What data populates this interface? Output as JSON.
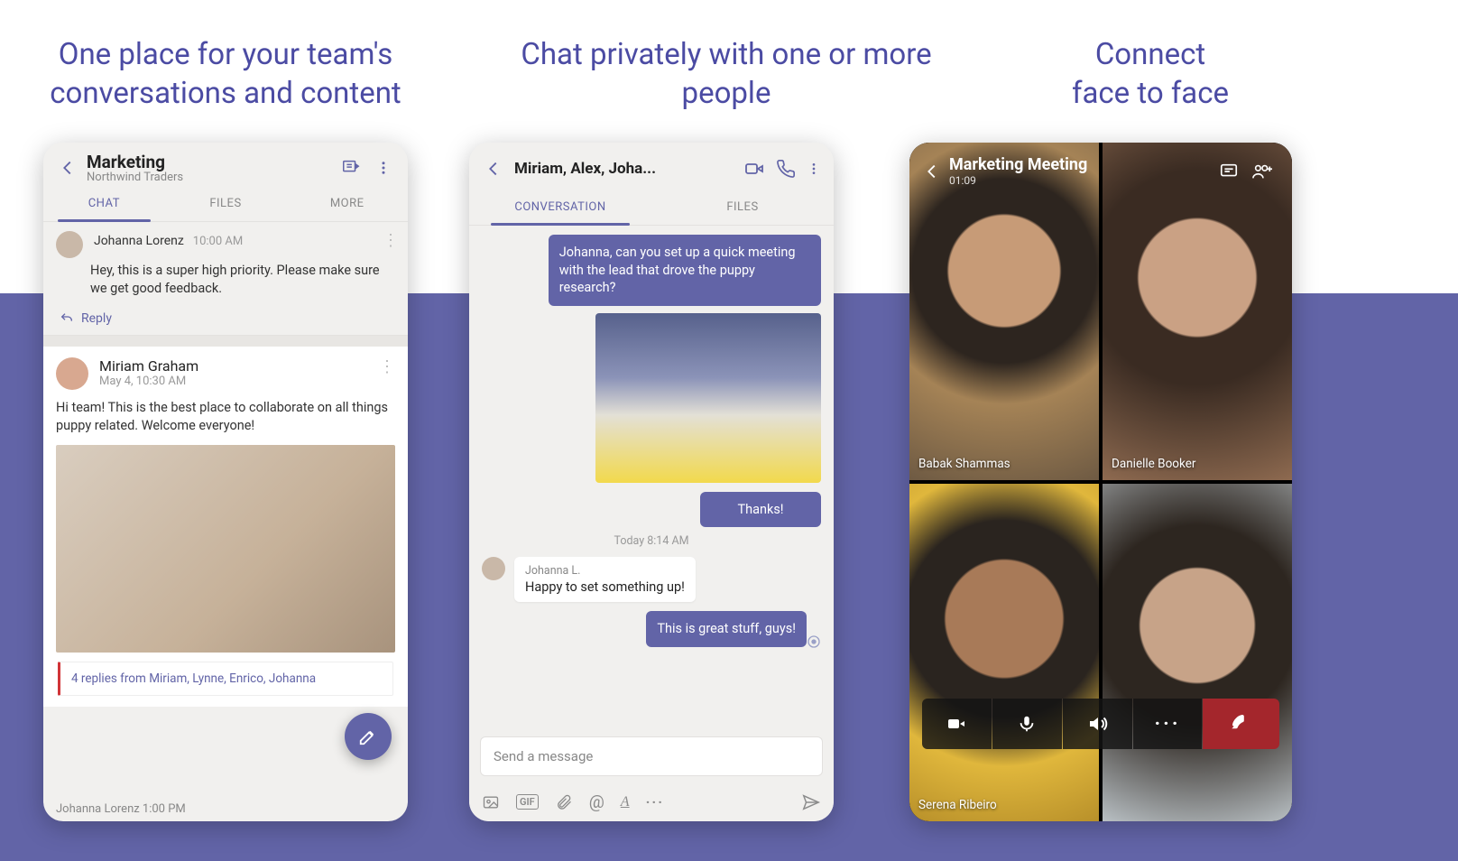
{
  "captions": {
    "c1": "One place for your team's conversations and content",
    "c2": "Chat privately with one or more people",
    "c3": "Connect\nface to face"
  },
  "phone1": {
    "header": {
      "title": "Marketing",
      "subtitle": "Northwind Traders"
    },
    "tabs": {
      "chat": "CHAT",
      "files": "FILES",
      "more": "MORE"
    },
    "msg1": {
      "name": "Johanna Lorenz",
      "time": "10:00 AM",
      "body": "Hey, this is a super high priority. Please make sure we get good feedback."
    },
    "reply_label": "Reply",
    "msg2": {
      "name": "Miriam Graham",
      "time": "May 4, 10:30 AM",
      "body": "Hi team! This is the best place to collaborate on all things puppy related. Welcome everyone!"
    },
    "replies_summary": "4 replies from Miriam, Lynne, Enrico, Johanna",
    "truncated_row": "Johanna Lorenz   1:00 PM"
  },
  "phone2": {
    "header_title": "Miriam, Alex, Joha...",
    "tabs": {
      "conv": "CONVERSATION",
      "files": "FILES"
    },
    "out1": "Johanna, can you set up a quick meeting with the lead that drove the puppy research?",
    "out2": "Thanks!",
    "day_sep": "Today 8:14 AM",
    "in_sender": "Johanna L.",
    "in_body": "Happy to set something up!",
    "out3": "This is great stuff, guys!",
    "composer_placeholder": "Send a message",
    "gif_label": "GIF"
  },
  "phone3": {
    "title": "Marketing Meeting",
    "elapsed": "01:09",
    "names": [
      "Babak Shammas",
      "Danielle Booker",
      "Serena Ribeiro",
      ""
    ]
  }
}
